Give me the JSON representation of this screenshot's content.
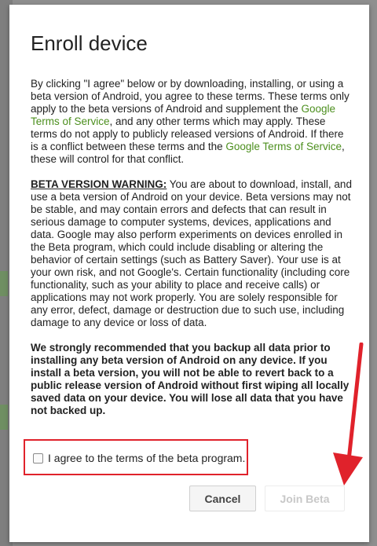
{
  "dialog": {
    "title": "Enroll device",
    "intro": {
      "part1": "By clicking \"I agree\" below or by downloading, installing, or using a beta version of Android, you agree to these terms. These terms only apply to the beta versions of Android and supplement the ",
      "link1": "Google Terms of Service",
      "part2": ", and any other terms which may apply. These terms do not apply to publicly released versions of Android. If there is a conflict between these terms and the ",
      "link2": "Google Terms of Service",
      "part3": ", these will control for that conflict."
    },
    "warning": {
      "heading": "BETA VERSION WARNING:",
      "text": " You are about to download, install, and use a beta version of Android on your device. Beta versions may not be stable, and may contain errors and defects that can result in serious damage to computer systems, devices, applications and data. Google may also perform experiments on devices enrolled in the Beta program, which could include disabling or altering the behavior of certain settings (such as Battery Saver). Your use is at your own risk, and not Google's. Certain functionality (including core functionality, such as your ability to place and receive calls) or applications may not work properly. You are solely responsible for any error, defect, damage or destruction due to such use, including damage to any device or loss of data."
    },
    "backup_notice": "We strongly recommended that you backup all data prior to installing any beta version of Android on any device. If you install a beta version, you will not be able to revert back to a public release version of Android without first wiping all locally saved data on your device. You will lose all data that you have not backed up.",
    "agree_label": "I agree to the terms of the beta program.",
    "agree_checked": false,
    "buttons": {
      "cancel": "Cancel",
      "join": "Join Beta"
    }
  },
  "colors": {
    "link": "#4c8f1e",
    "highlight_box": "#e0222b",
    "arrow": "#e0222b",
    "disabled_text": "#c8c8c8"
  }
}
